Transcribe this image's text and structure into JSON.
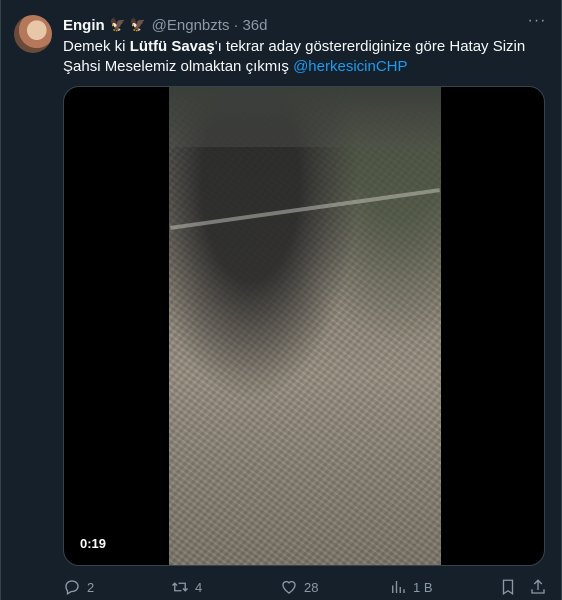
{
  "tweet": {
    "author_name": "Engin",
    "author_flags": "🦅 🦅",
    "handle": "@Engnbzts",
    "separator": "·",
    "time": "36d",
    "more": "···",
    "text_prefix": "Demek ki ",
    "text_bold": "Lütfü Savaş",
    "text_middle": "'ı tekrar aday göstererdiginize göre Hatay Sizin Şahsi Meselemiz olmaktan çıkmış ",
    "mention": "@herkesicinCHP"
  },
  "video": {
    "duration": "0:19"
  },
  "actions": {
    "replies": "2",
    "retweets": "4",
    "likes": "28",
    "views": "1 B"
  },
  "colors": {
    "background": "#15202b",
    "accent": "#1d9bf0",
    "muted": "#8b98a5"
  }
}
